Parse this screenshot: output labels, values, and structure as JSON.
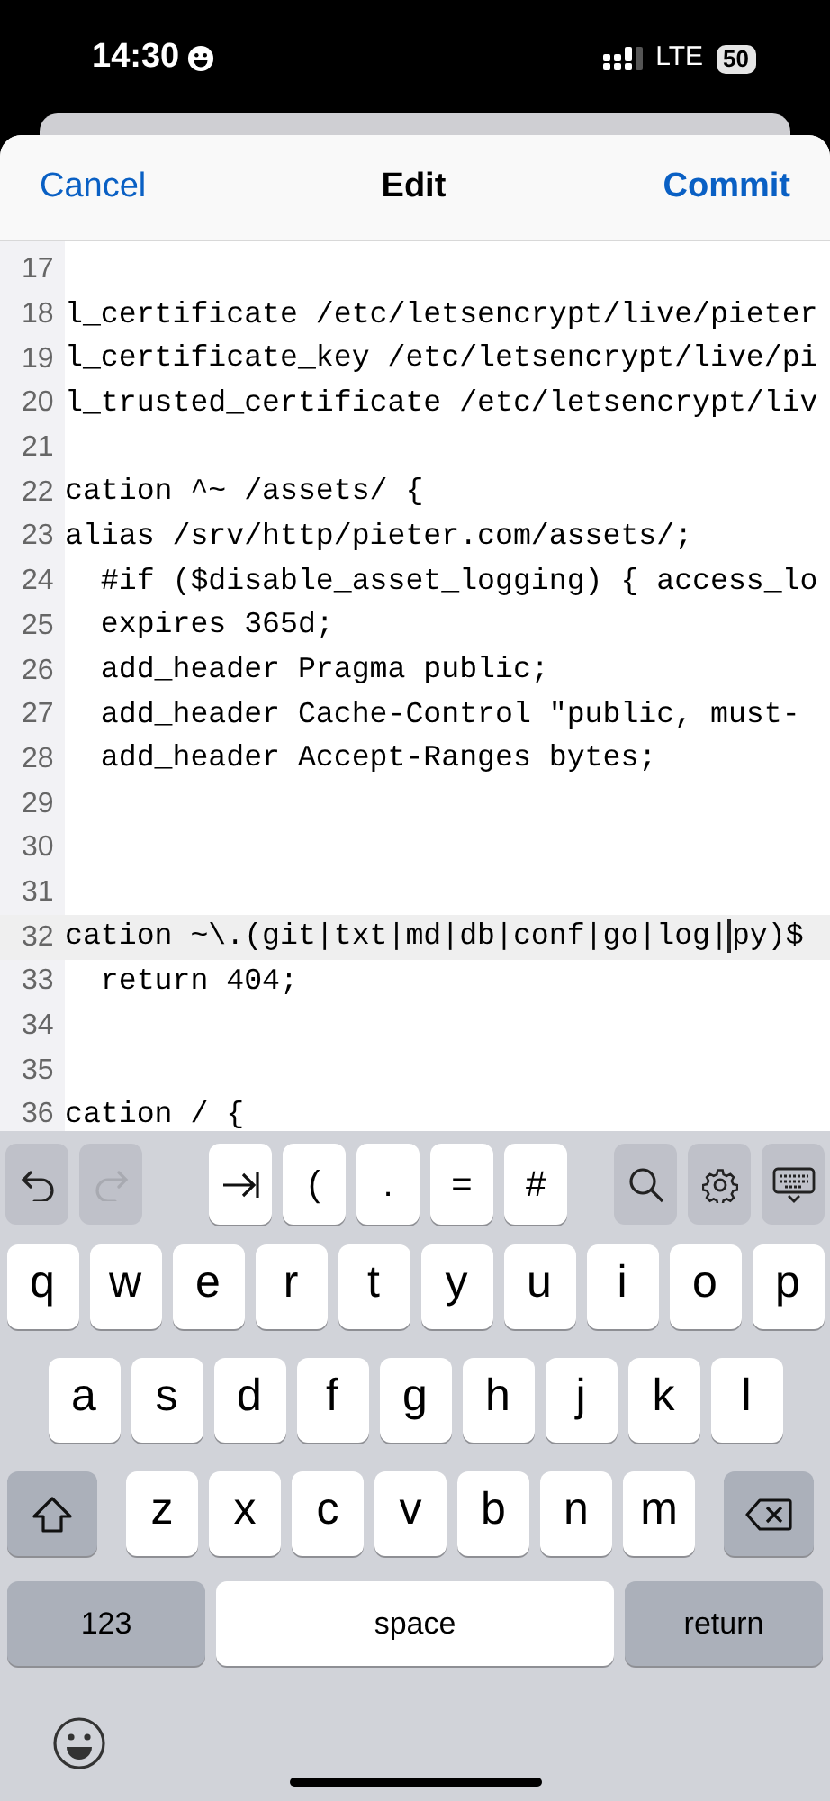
{
  "status_bar": {
    "time": "14:30",
    "network": "LTE",
    "battery": "50"
  },
  "header": {
    "cancel": "Cancel",
    "title": "Edit",
    "commit": "Commit"
  },
  "editor": {
    "lines": [
      {
        "number": "17",
        "current": false
      },
      {
        "number": "18",
        "text": "l_certificate /etc/letsencrypt/live/pieter",
        "current": false
      },
      {
        "number": "19",
        "text": "l_certificate_key /etc/letsencrypt/live/pi",
        "current": false
      },
      {
        "number": "20",
        "text": "l_trusted_certificate /etc/letsencrypt/liv",
        "current": false
      },
      {
        "number": "21",
        "current": false
      },
      {
        "number": "22",
        "text": "cation ^~ /assets/ {",
        "current": false
      },
      {
        "number": "23",
        "text": "alias /srv/http/pieter.com/assets/;",
        "current": false
      },
      {
        "number": "24",
        "text": "  #if ($disable_asset_logging) { access_lo",
        "current": false
      },
      {
        "number": "25",
        "text": "  expires 365d;",
        "current": false
      },
      {
        "number": "26",
        "text": "  add_header Pragma public;",
        "current": false
      },
      {
        "number": "27",
        "text": "  add_header Cache-Control \"public, must-",
        "current": false
      },
      {
        "number": "28",
        "text": "  add_header Accept-Ranges bytes;",
        "current": false
      },
      {
        "number": "29",
        "current": false
      },
      {
        "number": "30",
        "current": false
      },
      {
        "number": "31",
        "current": false
      },
      {
        "number": "32",
        "text": "cation ~\\.(git|txt|md|db|conf|go|log|",
        "text_after_cursor": "py)$",
        "current": true
      },
      {
        "number": "33",
        "text": "  return 404;",
        "current": false
      },
      {
        "number": "34",
        "current": false
      },
      {
        "number": "35",
        "current": false
      },
      {
        "number": "36",
        "text": "cation / {",
        "current": false
      }
    ]
  },
  "toolbar": [
    {
      "kind": "undo",
      "disabled": false
    },
    {
      "kind": "redo",
      "disabled": true
    },
    {
      "kind": "tab"
    },
    {
      "kind": "char",
      "label": "("
    },
    {
      "kind": "char",
      "label": "."
    },
    {
      "kind": "char",
      "label": "="
    },
    {
      "kind": "char",
      "label": "#"
    },
    {
      "kind": "search"
    },
    {
      "kind": "settings"
    },
    {
      "kind": "keyboard"
    }
  ],
  "keyboard": {
    "rows": [
      [
        "q",
        "w",
        "e",
        "r",
        "t",
        "y",
        "u",
        "i",
        "o",
        "p"
      ],
      [
        "a",
        "s",
        "d",
        "f",
        "g",
        "h",
        "j",
        "k",
        "l"
      ],
      [
        "z",
        "x",
        "c",
        "v",
        "b",
        "n",
        "m"
      ]
    ],
    "numbers_key": "123",
    "space_key": "space",
    "return_key": "return"
  }
}
